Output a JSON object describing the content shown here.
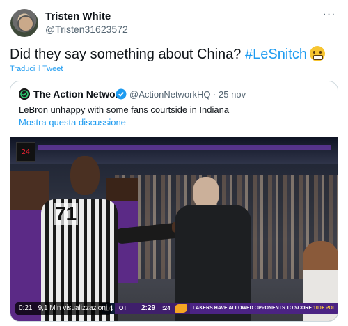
{
  "author": {
    "name": "Tristen White",
    "handle": "@Tristen31623572"
  },
  "tweet": {
    "text_prefix": "Did they say something about China? ",
    "hashtag": "#LeSnitch",
    "emoji": "grimacing-face-emoji",
    "translate_label": "Traduci il Tweet"
  },
  "more_menu_glyph": "···",
  "quoted": {
    "name": "The Action Network",
    "handle_date": "@ActionNetworkHQ · 25 nov",
    "text": "LeBron unhappy with some fans courtside in Indiana",
    "discussion_link": "Mostra questa discussione"
  },
  "video": {
    "elapsed_views": "0:21 | 9,1 Mln visualizzazioni",
    "referee_number": "71",
    "scoreboard": {
      "score": "14",
      "quarter": "OT",
      "clock": "2:29",
      "shot_clock": ":24",
      "banner_text": "LAKERS HAVE ALLOWED OPPONENTS TO SCORE ",
      "banner_highlight": "100+ POI"
    }
  },
  "colors": {
    "link": "#1d9bf0",
    "text": "#0f1419",
    "secondary": "#536471",
    "border": "#cfd9de",
    "lakers_purple": "#4b2383"
  }
}
